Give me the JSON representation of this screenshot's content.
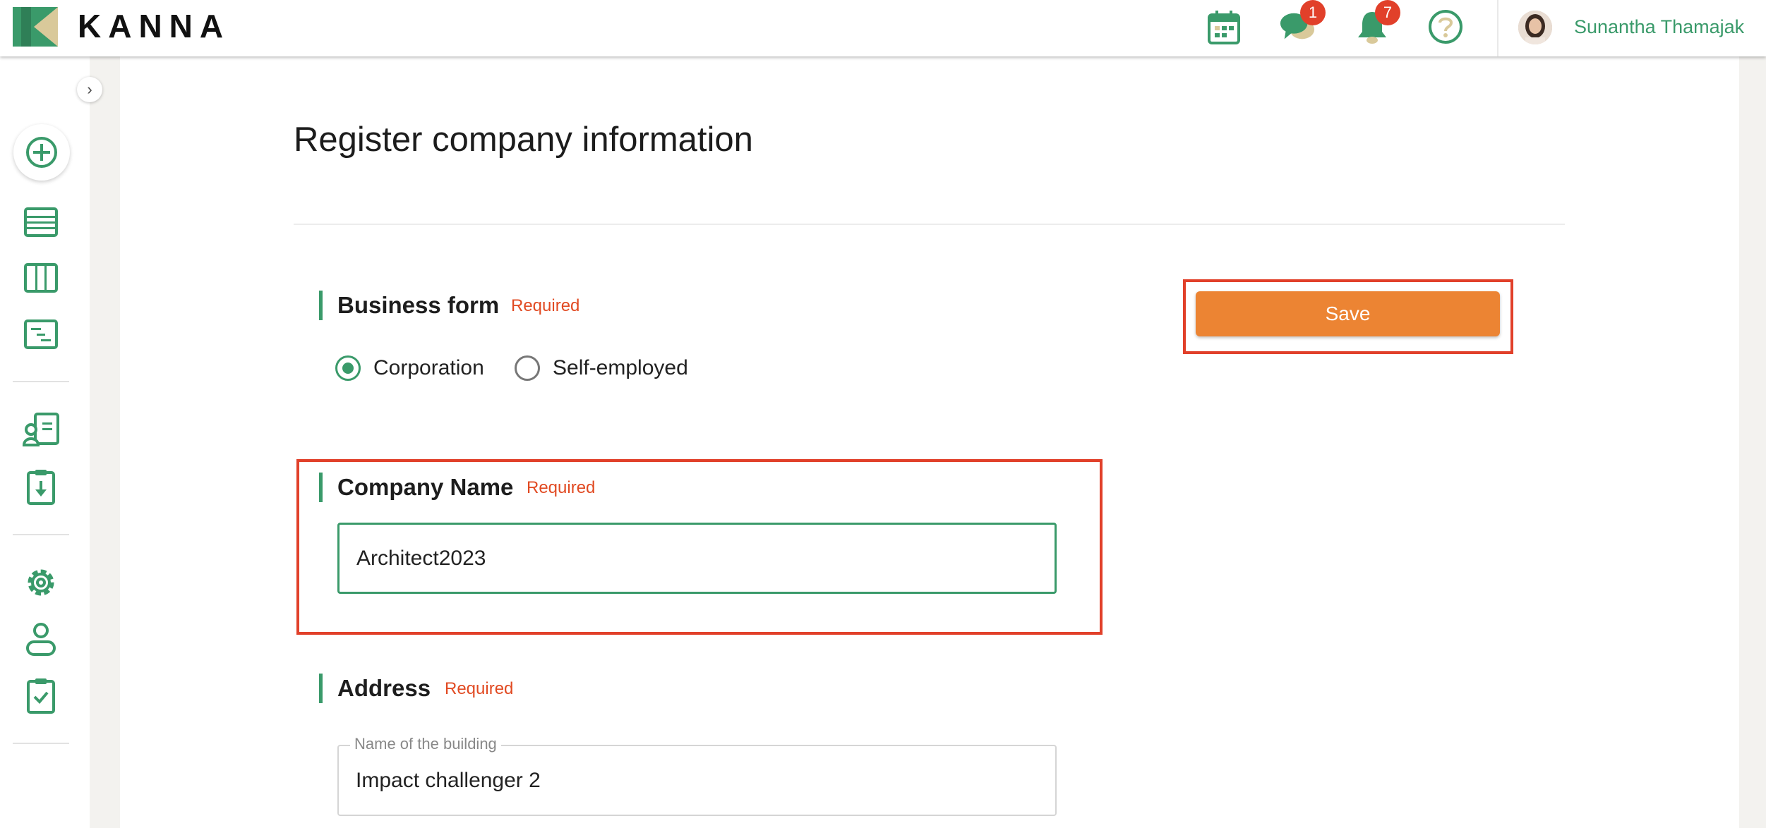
{
  "header": {
    "brand": "KANNA",
    "calendar_icon": "calendar-icon",
    "chat_icon": "chat-icon",
    "chat_badge": "1",
    "bell_icon": "bell-icon",
    "bell_badge": "7",
    "help_icon": "help-icon",
    "user_name": "Sunantha Thamajak"
  },
  "sidebar": {
    "collapse_glyph": "›",
    "items": [
      "add-icon",
      "list-icon",
      "board-icon",
      "gantt-icon",
      "contacts-icon",
      "download-icon",
      "settings-icon",
      "user-icon",
      "checklist-icon"
    ]
  },
  "form": {
    "title": "Register company information",
    "save_label": "Save",
    "business_form": {
      "label": "Business form",
      "required": "Required",
      "options": [
        "Corporation",
        "Self-employed"
      ],
      "selected": "Corporation"
    },
    "company_name": {
      "label": "Company Name",
      "required": "Required",
      "value": "Architect2023"
    },
    "address": {
      "label": "Address",
      "required": "Required",
      "building_label": "Name of the building",
      "building_value": "Impact challenger 2"
    }
  },
  "colors": {
    "accent_green": "#3a9a6a",
    "save_orange": "#ec8433",
    "required_red": "#e14a22",
    "highlight_red": "#e1402a"
  }
}
